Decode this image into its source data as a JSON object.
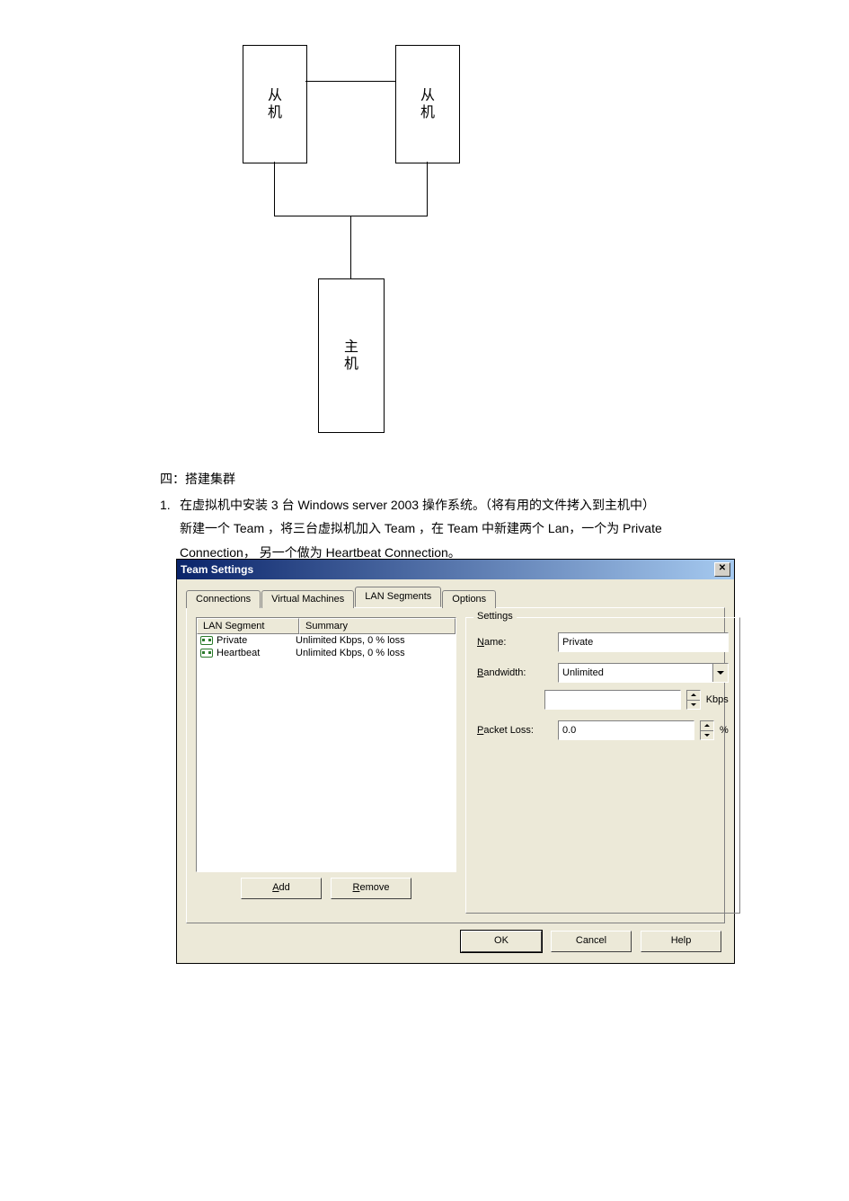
{
  "diagram": {
    "slave_label": "从\n机",
    "master_label": "主\n机"
  },
  "doc": {
    "section_header": "四：搭建集群",
    "item1_num": "1.",
    "item1_line1": "在虚拟机中安装 3 台 Windows server 2003 操作系统。（将有用的文件拷入到主机中）",
    "item1_line2": "新建一个 Team ，将三台虚拟机加入 Team ，在 Team 中新建两个 Lan，一个为 Private",
    "item1_line3": "Connection， 另一个做为 Heartbeat Connection。"
  },
  "dialog": {
    "title": "Team Settings",
    "close_glyph": "✕",
    "tabs": {
      "connections": "Connections",
      "vms": "Virtual Machines",
      "lan": "LAN Segments",
      "options": "Options"
    },
    "list": {
      "col_segment": "LAN Segment",
      "col_summary": "Summary",
      "rows": [
        {
          "name": "Private",
          "summary": "Unlimited Kbps, 0 % loss"
        },
        {
          "name": "Heartbeat",
          "summary": "Unlimited Kbps, 0 % loss"
        }
      ]
    },
    "buttons": {
      "add": "Add",
      "add_u": "A",
      "remove": "Remove",
      "remove_u": "R",
      "ok": "OK",
      "cancel": "Cancel",
      "help": "Help"
    },
    "settings": {
      "legend": "Settings",
      "name_label": "Name:",
      "name_label_u": "N",
      "name_value": "Private",
      "bandwidth_label": "Bandwidth:",
      "bandwidth_label_u": "B",
      "bandwidth_value": "Unlimited",
      "bandwidth_unit": "Kbps",
      "bandwidth_num": "",
      "packet_label": "Packet Loss:",
      "packet_label_u": "P",
      "packet_value": "0.0",
      "packet_unit": "%"
    }
  }
}
